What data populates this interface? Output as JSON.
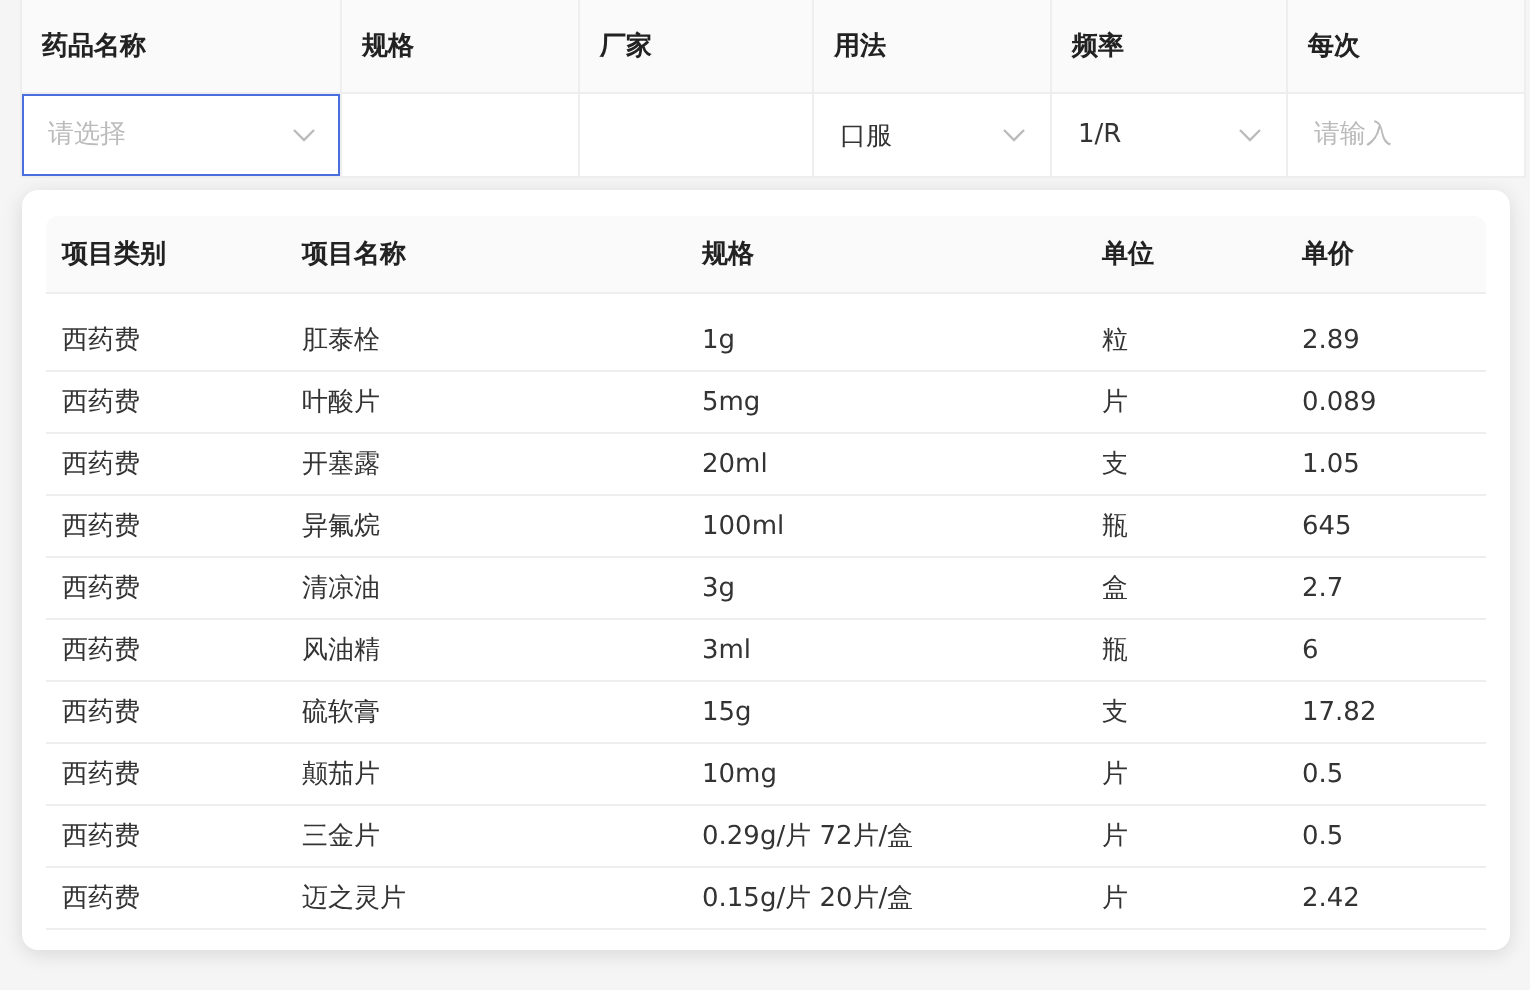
{
  "form_table": {
    "columns": [
      "药品名称",
      "规格",
      "厂家",
      "用法",
      "频率",
      "每次"
    ],
    "cells": [
      {
        "kind": "select",
        "placeholder": "请选择",
        "focused": true
      },
      {
        "kind": "empty"
      },
      {
        "kind": "empty"
      },
      {
        "kind": "select",
        "value": "口服",
        "focused": false
      },
      {
        "kind": "select",
        "value": "1/R",
        "focused": false
      },
      {
        "kind": "input",
        "placeholder": "请输入",
        "focused": false
      }
    ]
  },
  "dropdown": {
    "columns": [
      "项目类别",
      "项目名称",
      "规格",
      "单位",
      "单价"
    ],
    "rows": [
      [
        "西药费",
        "肛泰栓",
        "1g",
        "粒",
        "2.89"
      ],
      [
        "西药费",
        "叶酸片",
        "5mg",
        "片",
        "0.089"
      ],
      [
        "西药费",
        "开塞露",
        "20ml",
        "支",
        "1.05"
      ],
      [
        "西药费",
        "异氟烷",
        "100ml",
        "瓶",
        "645"
      ],
      [
        "西药费",
        "清凉油",
        "3g",
        "盒",
        "2.7"
      ],
      [
        "西药费",
        "风油精",
        "3ml",
        "瓶",
        "6"
      ],
      [
        "西药费",
        "硫软膏",
        "15g",
        "支",
        "17.82"
      ],
      [
        "西药费",
        "颠茄片",
        "10mg",
        "片",
        "0.5"
      ],
      [
        "西药费",
        "三金片",
        "0.29g/片 72片/盒",
        "片",
        "0.5"
      ],
      [
        "西药费",
        "迈之灵片",
        "0.15g/片 20片/盒",
        "片",
        "2.42"
      ]
    ]
  }
}
